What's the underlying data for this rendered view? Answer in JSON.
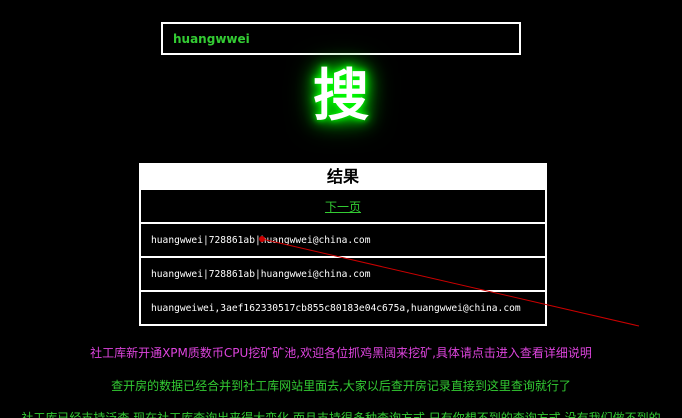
{
  "search": {
    "value": "huangwwei"
  },
  "search_button_glyph": "搜",
  "results": {
    "title": "结果",
    "next_page_label": "下一页",
    "rows": [
      "huangwwei|728861ab|huangwwei@china.com",
      "huangwwei|728861ab|huangwwei@china.com",
      "huangweiwei,3aef162330517cb855c80183e04c675a,huangwwei@china.com"
    ]
  },
  "notices": {
    "mining": "社工库新开通XPM质数币CPU挖矿矿池,欢迎各位抓鸡黑阔来挖矿,具体请点击进入查看详细说明",
    "merged": "查开房的数据已经合并到社工库网站里面去,大家以后查开房记录直接到这里查询就行了",
    "truncated": "社工库已经支持泛查,现在社工库查询出来得大变化,而且支持很多种查询方式,只有你想不到的查询方式,没有我们做不到的"
  },
  "colors": {
    "background": "#000000",
    "accent_green": "#33cc33",
    "notice_magenta": "#dd44dd",
    "annotation_red": "#cc0000"
  }
}
